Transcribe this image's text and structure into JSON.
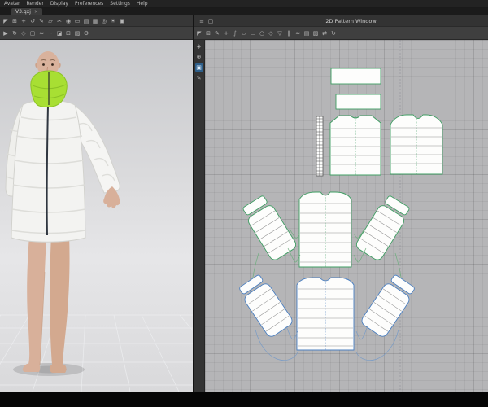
{
  "menu_bar": {
    "items": [
      "Avatar",
      "Render",
      "Display",
      "Preferences",
      "Settings",
      "Help"
    ]
  },
  "tab_bar": {
    "active_tab": "V3.qxj",
    "close_glyph": "×"
  },
  "pattern_window": {
    "title": "2D Pattern Window"
  },
  "colors": {
    "pattern_outline_green": "#3f9e63",
    "pattern_outline_blue": "#4a7fc1",
    "collar_green": "#a8df33",
    "toolbar_active_blue": "#2e5f8a"
  },
  "toolbars": {
    "left_row1": [
      {
        "name": "select-tool",
        "glyph": "◤"
      },
      {
        "name": "transform-tool",
        "glyph": "⊞"
      },
      {
        "name": "move-tool",
        "glyph": "+"
      },
      {
        "name": "rotate-tool",
        "glyph": "↺"
      },
      {
        "name": "pen-tool",
        "glyph": "✎"
      },
      {
        "name": "edit-pattern-tool",
        "glyph": "▱"
      },
      {
        "name": "scissors-tool",
        "glyph": "✂"
      },
      {
        "name": "pin-tool",
        "glyph": "◉"
      },
      {
        "name": "tape-measure-tool",
        "glyph": "▭"
      },
      {
        "name": "flatten-tool",
        "glyph": "▤"
      },
      {
        "name": "grid-snap-tool",
        "glyph": "▦"
      },
      {
        "name": "camera-tool",
        "glyph": "◎"
      },
      {
        "name": "light-tool",
        "glyph": "☀"
      },
      {
        "name": "render-tool",
        "glyph": "▣"
      }
    ],
    "left_row2": [
      {
        "name": "simulate-button",
        "glyph": "▶"
      },
      {
        "name": "reset-button",
        "glyph": "↻"
      },
      {
        "name": "avatar-display-button",
        "glyph": "◇"
      },
      {
        "name": "garment-display-button",
        "glyph": "▢"
      },
      {
        "name": "pressure-tool",
        "glyph": "≈"
      },
      {
        "name": "wind-tool",
        "glyph": "~"
      },
      {
        "name": "fold-arrange-button",
        "glyph": "◪"
      },
      {
        "name": "pin-box-button",
        "glyph": "⊡"
      },
      {
        "name": "mesh-view-button",
        "glyph": "▨"
      },
      {
        "name": "settings-button",
        "glyph": "⚙"
      }
    ],
    "right_row": [
      {
        "name": "pattern-select-tool",
        "glyph": "◤"
      },
      {
        "name": "pattern-transform-tool",
        "glyph": "⊞"
      },
      {
        "name": "edit-point-tool",
        "glyph": "✎"
      },
      {
        "name": "add-point-tool",
        "glyph": "+"
      },
      {
        "name": "edit-curve-tool",
        "glyph": "∫"
      },
      {
        "name": "polygon-tool",
        "glyph": "▱"
      },
      {
        "name": "rectangle-tool",
        "glyph": "▭"
      },
      {
        "name": "circle-tool",
        "glyph": "○"
      },
      {
        "name": "dart-tool",
        "glyph": "◇"
      },
      {
        "name": "notch-tool",
        "glyph": "▽"
      },
      {
        "name": "segment-sew-tool",
        "glyph": "∥"
      },
      {
        "name": "free-sew-tool",
        "glyph": "≈"
      },
      {
        "name": "grading-tool",
        "glyph": "▤"
      },
      {
        "name": "texture-tool",
        "glyph": "▨"
      },
      {
        "name": "symmetry-tool",
        "glyph": "⇄"
      },
      {
        "name": "sync-tool",
        "glyph": "↻"
      }
    ],
    "side_col": [
      {
        "name": "pan-tool",
        "glyph": "◈"
      },
      {
        "name": "zoom-tool",
        "glyph": "⊕"
      },
      {
        "name": "sync-2d3d-tool",
        "glyph": "▣",
        "active": true
      },
      {
        "name": "brush-tool",
        "glyph": "✎"
      }
    ],
    "title_icons": [
      {
        "name": "window-menu",
        "glyph": "≡"
      },
      {
        "name": "float-window",
        "glyph": "▢"
      }
    ]
  }
}
